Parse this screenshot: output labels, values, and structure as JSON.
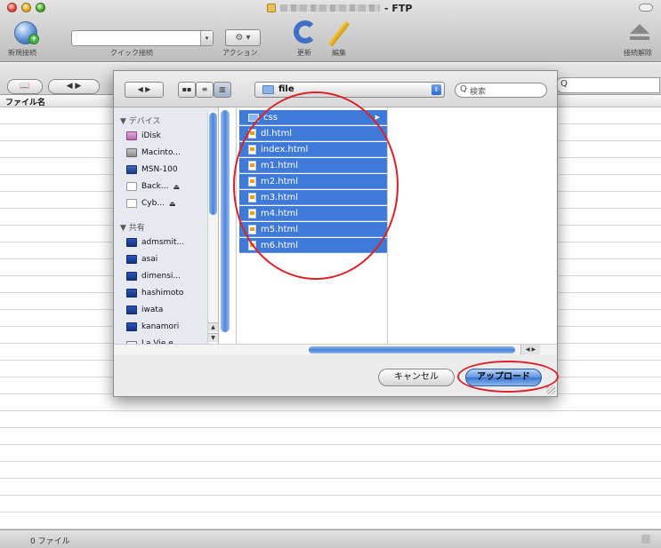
{
  "window": {
    "title": "- FTP"
  },
  "toolbar": {
    "new_connection_label": "新規接続",
    "quick_connect_label": "クイック接続",
    "action_label": "アクション",
    "refresh_label": "更新",
    "edit_label": "編集",
    "disconnect_label": "接続解除",
    "action_glyph": "⚙ ▾"
  },
  "browser_nav": {
    "bookmarks_glyph": "📖",
    "back_forward_glyph": "◀ ▶"
  },
  "file_list": {
    "column_header": "ファイル名",
    "search_glyph": "Q"
  },
  "status": {
    "file_count": "0 ファイル"
  },
  "sheet": {
    "back_forward_glyph": "◀ ▶",
    "view_icon_glyph": "▪▪",
    "view_list_glyph": "≡",
    "view_column_glyph": "▥",
    "location": "file",
    "search_placeholder": "検索",
    "search_glyph": "Q",
    "sidebar": {
      "devices_header": "▼ デバイス",
      "devices": [
        {
          "label": "iDisk",
          "icon": "idisk-icon"
        },
        {
          "label": "Macinto...",
          "icon": "hard-drive-icon"
        },
        {
          "label": "MSN-100",
          "icon": "monitor-icon"
        },
        {
          "label": "Back...",
          "icon": "document-icon",
          "eject": "⏏"
        },
        {
          "label": "Cyb...",
          "icon": "document-icon",
          "eject": "⏏"
        }
      ],
      "shared_header": "▼ 共有",
      "shared": [
        {
          "label": "admsmit..."
        },
        {
          "label": "asai"
        },
        {
          "label": "dimensi..."
        },
        {
          "label": "hashimoto"
        },
        {
          "label": "iwata"
        },
        {
          "label": "kanamori"
        },
        {
          "label": "La Vie e..."
        }
      ]
    },
    "files": [
      {
        "label": "css",
        "kind": "folder"
      },
      {
        "label": "dl.html",
        "kind": "file"
      },
      {
        "label": "index.html",
        "kind": "file"
      },
      {
        "label": "m1.html",
        "kind": "file"
      },
      {
        "label": "m2.html",
        "kind": "file"
      },
      {
        "label": "m3.html",
        "kind": "file"
      },
      {
        "label": "m4.html",
        "kind": "file"
      },
      {
        "label": "m5.html",
        "kind": "file"
      },
      {
        "label": "m6.html",
        "kind": "file"
      }
    ],
    "cancel_label": "キャンセル",
    "upload_label": "アップロード"
  },
  "colors": {
    "selection": "#3f7ad8",
    "annotation": "#d8232a",
    "default_button": "#5e94e2"
  }
}
